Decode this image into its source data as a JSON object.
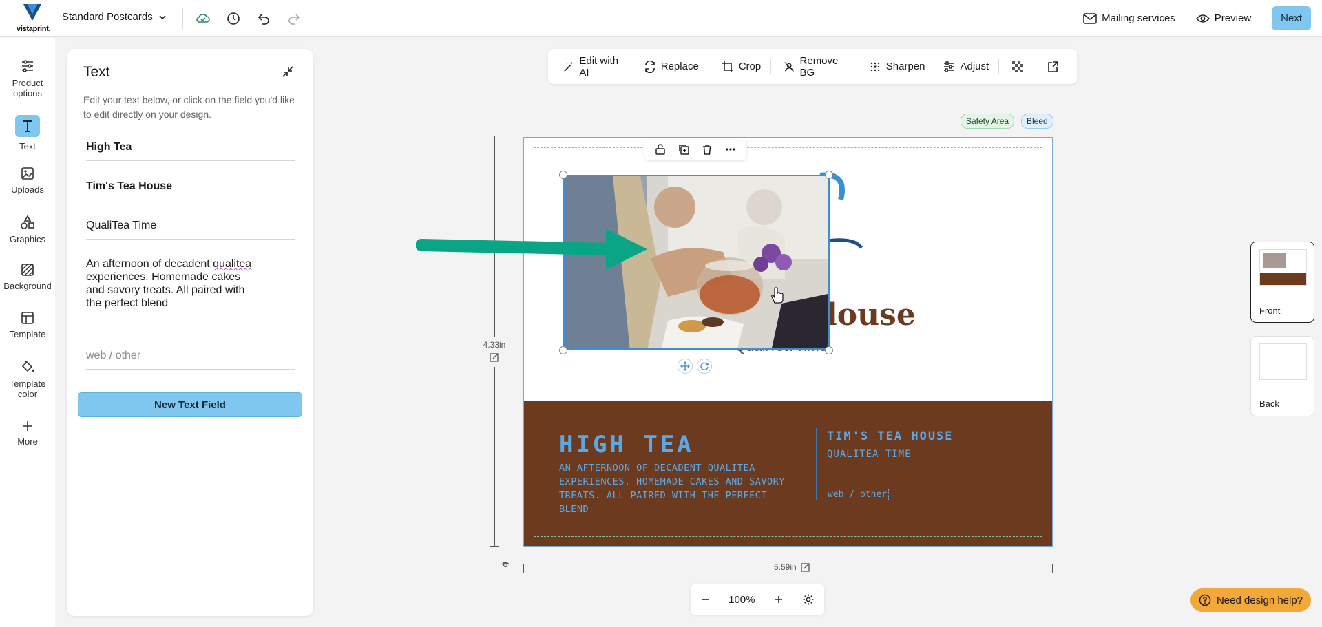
{
  "header": {
    "logo_text": "vistaprint.",
    "doc_title": "Standard Postcards",
    "mailing_label": "Mailing services",
    "preview_label": "Preview",
    "next_label": "Next"
  },
  "rail": [
    {
      "label_1": "Product",
      "label_2": "options",
      "icon": "sliders-icon"
    },
    {
      "label_1": "Text",
      "icon": "text-icon"
    },
    {
      "label_1": "Uploads",
      "icon": "image-icon"
    },
    {
      "label_1": "Graphics",
      "icon": "shapes-icon"
    },
    {
      "label_1": "Background",
      "icon": "background-icon"
    },
    {
      "label_1": "Template",
      "icon": "template-icon"
    },
    {
      "label_1": "Template",
      "label_2": "color",
      "icon": "paint-bucket-icon"
    },
    {
      "label_1": "More",
      "icon": "plus-icon"
    }
  ],
  "panel": {
    "title": "Text",
    "hint": "Edit your text below, or click on the field you'd like to edit directly on your design.",
    "fields": [
      "High Tea",
      "Tim's Tea House",
      "QualiTea Time"
    ],
    "multi_pre": "An afternoon of decadent",
    "multi_squig": "qualitea",
    "multi_post": "experiences. Homemade cakes and savory treats. All paired with the perfect blend",
    "placeholder_field": "web / other",
    "new_field_label": "New Text Field"
  },
  "toolbar": {
    "edit_ai": "Edit with AI",
    "replace": "Replace",
    "crop": "Crop",
    "remove_bg": "Remove BG",
    "sharpen": "Sharpen",
    "adjust": "Adjust"
  },
  "badges": {
    "safety": "Safety Area",
    "bleed": "Bleed"
  },
  "design": {
    "left_title": "HIGH TEA",
    "left_body": "An afternoon of decadent qualitea experiences. Homemade cakes and savory treats. All paired with the perfect blend",
    "right_title": "TIM'S TEA HOUSE",
    "right_sub": "QUALITEA TIME",
    "right_web": "web / other",
    "white_house": "louse",
    "white_quali": "QualiTea Time"
  },
  "rulers": {
    "height": "4.33in",
    "width": "5.59in"
  },
  "zoom": {
    "value": "100%"
  },
  "pages": {
    "front": "Front",
    "back": "Back"
  },
  "help_label": "Need design help?",
  "colors": {
    "accent": "#7fc7ee",
    "brown": "#6b3a1f",
    "design_blue": "#5aa9e6",
    "arrow": "#0aa584",
    "help": "#f3a83a"
  }
}
